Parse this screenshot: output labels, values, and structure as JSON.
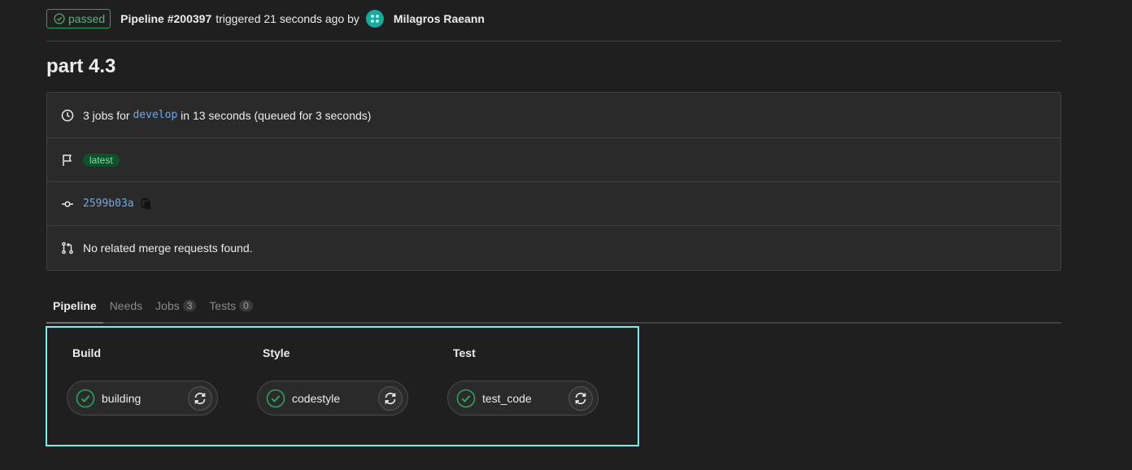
{
  "header": {
    "status_label": "passed",
    "pipeline_label": "Pipeline #200397",
    "triggered_text": "triggered 21 seconds ago by",
    "user_name": "Milagros Raeann"
  },
  "title": "part 4.3",
  "info": {
    "jobs_prefix": "3 jobs for",
    "branch": "develop",
    "jobs_suffix": "in 13 seconds (queued for 3 seconds)",
    "tag": "latest",
    "commit_sha": "2599b03a",
    "merge_requests_text": "No related merge requests found."
  },
  "tabs": [
    {
      "label": "Pipeline"
    },
    {
      "label": "Needs"
    },
    {
      "label": "Jobs",
      "count": "3"
    },
    {
      "label": "Tests",
      "count": "0"
    }
  ],
  "stages": [
    {
      "title": "Build",
      "job": "building"
    },
    {
      "title": "Style",
      "job": "codestyle"
    },
    {
      "title": "Test",
      "job": "test_code"
    }
  ],
  "colors": {
    "success": "#2da160",
    "link": "#71a9e6",
    "highlight": "#6ff2f2"
  },
  "icons": {
    "status": "check-circle-icon",
    "clock": "clock-icon",
    "flag": "flag-icon",
    "commit": "commit-icon",
    "copy": "copy-icon",
    "merge_request": "merge-request-icon",
    "retry": "retry-icon"
  }
}
